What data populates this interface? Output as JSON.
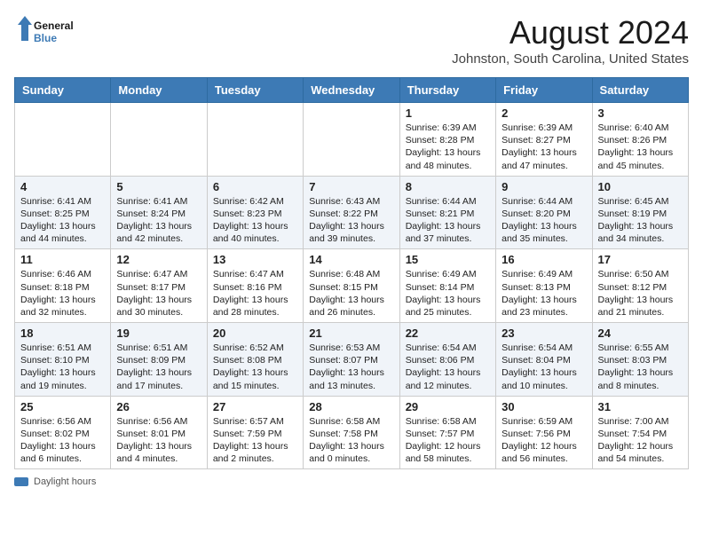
{
  "header": {
    "logo_line1": "General",
    "logo_line2": "Blue",
    "title": "August 2024",
    "subtitle": "Johnston, South Carolina, United States"
  },
  "weekdays": [
    "Sunday",
    "Monday",
    "Tuesday",
    "Wednesday",
    "Thursday",
    "Friday",
    "Saturday"
  ],
  "weeks": [
    [
      {
        "day": "",
        "info": ""
      },
      {
        "day": "",
        "info": ""
      },
      {
        "day": "",
        "info": ""
      },
      {
        "day": "",
        "info": ""
      },
      {
        "day": "1",
        "info": "Sunrise: 6:39 AM\nSunset: 8:28 PM\nDaylight: 13 hours and 48 minutes."
      },
      {
        "day": "2",
        "info": "Sunrise: 6:39 AM\nSunset: 8:27 PM\nDaylight: 13 hours and 47 minutes."
      },
      {
        "day": "3",
        "info": "Sunrise: 6:40 AM\nSunset: 8:26 PM\nDaylight: 13 hours and 45 minutes."
      }
    ],
    [
      {
        "day": "4",
        "info": "Sunrise: 6:41 AM\nSunset: 8:25 PM\nDaylight: 13 hours and 44 minutes."
      },
      {
        "day": "5",
        "info": "Sunrise: 6:41 AM\nSunset: 8:24 PM\nDaylight: 13 hours and 42 minutes."
      },
      {
        "day": "6",
        "info": "Sunrise: 6:42 AM\nSunset: 8:23 PM\nDaylight: 13 hours and 40 minutes."
      },
      {
        "day": "7",
        "info": "Sunrise: 6:43 AM\nSunset: 8:22 PM\nDaylight: 13 hours and 39 minutes."
      },
      {
        "day": "8",
        "info": "Sunrise: 6:44 AM\nSunset: 8:21 PM\nDaylight: 13 hours and 37 minutes."
      },
      {
        "day": "9",
        "info": "Sunrise: 6:44 AM\nSunset: 8:20 PM\nDaylight: 13 hours and 35 minutes."
      },
      {
        "day": "10",
        "info": "Sunrise: 6:45 AM\nSunset: 8:19 PM\nDaylight: 13 hours and 34 minutes."
      }
    ],
    [
      {
        "day": "11",
        "info": "Sunrise: 6:46 AM\nSunset: 8:18 PM\nDaylight: 13 hours and 32 minutes."
      },
      {
        "day": "12",
        "info": "Sunrise: 6:47 AM\nSunset: 8:17 PM\nDaylight: 13 hours and 30 minutes."
      },
      {
        "day": "13",
        "info": "Sunrise: 6:47 AM\nSunset: 8:16 PM\nDaylight: 13 hours and 28 minutes."
      },
      {
        "day": "14",
        "info": "Sunrise: 6:48 AM\nSunset: 8:15 PM\nDaylight: 13 hours and 26 minutes."
      },
      {
        "day": "15",
        "info": "Sunrise: 6:49 AM\nSunset: 8:14 PM\nDaylight: 13 hours and 25 minutes."
      },
      {
        "day": "16",
        "info": "Sunrise: 6:49 AM\nSunset: 8:13 PM\nDaylight: 13 hours and 23 minutes."
      },
      {
        "day": "17",
        "info": "Sunrise: 6:50 AM\nSunset: 8:12 PM\nDaylight: 13 hours and 21 minutes."
      }
    ],
    [
      {
        "day": "18",
        "info": "Sunrise: 6:51 AM\nSunset: 8:10 PM\nDaylight: 13 hours and 19 minutes."
      },
      {
        "day": "19",
        "info": "Sunrise: 6:51 AM\nSunset: 8:09 PM\nDaylight: 13 hours and 17 minutes."
      },
      {
        "day": "20",
        "info": "Sunrise: 6:52 AM\nSunset: 8:08 PM\nDaylight: 13 hours and 15 minutes."
      },
      {
        "day": "21",
        "info": "Sunrise: 6:53 AM\nSunset: 8:07 PM\nDaylight: 13 hours and 13 minutes."
      },
      {
        "day": "22",
        "info": "Sunrise: 6:54 AM\nSunset: 8:06 PM\nDaylight: 13 hours and 12 minutes."
      },
      {
        "day": "23",
        "info": "Sunrise: 6:54 AM\nSunset: 8:04 PM\nDaylight: 13 hours and 10 minutes."
      },
      {
        "day": "24",
        "info": "Sunrise: 6:55 AM\nSunset: 8:03 PM\nDaylight: 13 hours and 8 minutes."
      }
    ],
    [
      {
        "day": "25",
        "info": "Sunrise: 6:56 AM\nSunset: 8:02 PM\nDaylight: 13 hours and 6 minutes."
      },
      {
        "day": "26",
        "info": "Sunrise: 6:56 AM\nSunset: 8:01 PM\nDaylight: 13 hours and 4 minutes."
      },
      {
        "day": "27",
        "info": "Sunrise: 6:57 AM\nSunset: 7:59 PM\nDaylight: 13 hours and 2 minutes."
      },
      {
        "day": "28",
        "info": "Sunrise: 6:58 AM\nSunset: 7:58 PM\nDaylight: 13 hours and 0 minutes."
      },
      {
        "day": "29",
        "info": "Sunrise: 6:58 AM\nSunset: 7:57 PM\nDaylight: 12 hours and 58 minutes."
      },
      {
        "day": "30",
        "info": "Sunrise: 6:59 AM\nSunset: 7:56 PM\nDaylight: 12 hours and 56 minutes."
      },
      {
        "day": "31",
        "info": "Sunrise: 7:00 AM\nSunset: 7:54 PM\nDaylight: 12 hours and 54 minutes."
      }
    ]
  ],
  "footer": {
    "label": "Daylight hours"
  }
}
